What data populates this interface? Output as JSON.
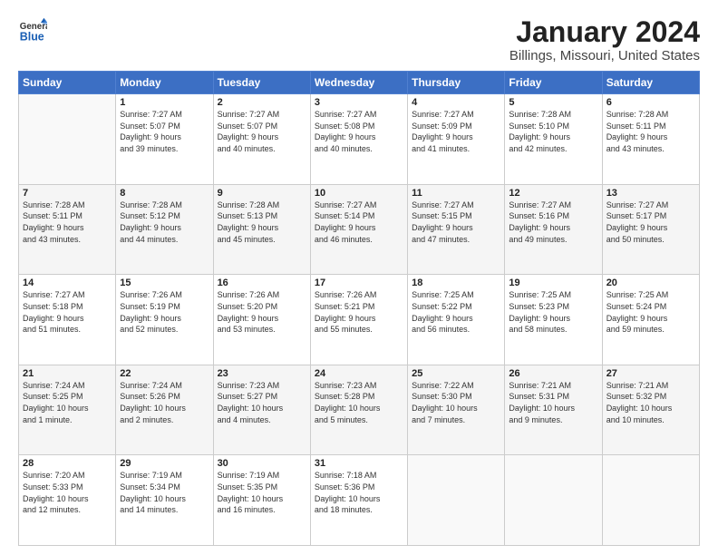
{
  "logo": {
    "general": "General",
    "blue": "Blue"
  },
  "header": {
    "title": "January 2024",
    "subtitle": "Billings, Missouri, United States"
  },
  "weekdays": [
    "Sunday",
    "Monday",
    "Tuesday",
    "Wednesday",
    "Thursday",
    "Friday",
    "Saturday"
  ],
  "weeks": [
    [
      {
        "day": "",
        "info": ""
      },
      {
        "day": "1",
        "info": "Sunrise: 7:27 AM\nSunset: 5:07 PM\nDaylight: 9 hours\nand 39 minutes."
      },
      {
        "day": "2",
        "info": "Sunrise: 7:27 AM\nSunset: 5:07 PM\nDaylight: 9 hours\nand 40 minutes."
      },
      {
        "day": "3",
        "info": "Sunrise: 7:27 AM\nSunset: 5:08 PM\nDaylight: 9 hours\nand 40 minutes."
      },
      {
        "day": "4",
        "info": "Sunrise: 7:27 AM\nSunset: 5:09 PM\nDaylight: 9 hours\nand 41 minutes."
      },
      {
        "day": "5",
        "info": "Sunrise: 7:28 AM\nSunset: 5:10 PM\nDaylight: 9 hours\nand 42 minutes."
      },
      {
        "day": "6",
        "info": "Sunrise: 7:28 AM\nSunset: 5:11 PM\nDaylight: 9 hours\nand 43 minutes."
      }
    ],
    [
      {
        "day": "7",
        "info": "Sunrise: 7:28 AM\nSunset: 5:11 PM\nDaylight: 9 hours\nand 43 minutes."
      },
      {
        "day": "8",
        "info": "Sunrise: 7:28 AM\nSunset: 5:12 PM\nDaylight: 9 hours\nand 44 minutes."
      },
      {
        "day": "9",
        "info": "Sunrise: 7:28 AM\nSunset: 5:13 PM\nDaylight: 9 hours\nand 45 minutes."
      },
      {
        "day": "10",
        "info": "Sunrise: 7:27 AM\nSunset: 5:14 PM\nDaylight: 9 hours\nand 46 minutes."
      },
      {
        "day": "11",
        "info": "Sunrise: 7:27 AM\nSunset: 5:15 PM\nDaylight: 9 hours\nand 47 minutes."
      },
      {
        "day": "12",
        "info": "Sunrise: 7:27 AM\nSunset: 5:16 PM\nDaylight: 9 hours\nand 49 minutes."
      },
      {
        "day": "13",
        "info": "Sunrise: 7:27 AM\nSunset: 5:17 PM\nDaylight: 9 hours\nand 50 minutes."
      }
    ],
    [
      {
        "day": "14",
        "info": "Sunrise: 7:27 AM\nSunset: 5:18 PM\nDaylight: 9 hours\nand 51 minutes."
      },
      {
        "day": "15",
        "info": "Sunrise: 7:26 AM\nSunset: 5:19 PM\nDaylight: 9 hours\nand 52 minutes."
      },
      {
        "day": "16",
        "info": "Sunrise: 7:26 AM\nSunset: 5:20 PM\nDaylight: 9 hours\nand 53 minutes."
      },
      {
        "day": "17",
        "info": "Sunrise: 7:26 AM\nSunset: 5:21 PM\nDaylight: 9 hours\nand 55 minutes."
      },
      {
        "day": "18",
        "info": "Sunrise: 7:25 AM\nSunset: 5:22 PM\nDaylight: 9 hours\nand 56 minutes."
      },
      {
        "day": "19",
        "info": "Sunrise: 7:25 AM\nSunset: 5:23 PM\nDaylight: 9 hours\nand 58 minutes."
      },
      {
        "day": "20",
        "info": "Sunrise: 7:25 AM\nSunset: 5:24 PM\nDaylight: 9 hours\nand 59 minutes."
      }
    ],
    [
      {
        "day": "21",
        "info": "Sunrise: 7:24 AM\nSunset: 5:25 PM\nDaylight: 10 hours\nand 1 minute."
      },
      {
        "day": "22",
        "info": "Sunrise: 7:24 AM\nSunset: 5:26 PM\nDaylight: 10 hours\nand 2 minutes."
      },
      {
        "day": "23",
        "info": "Sunrise: 7:23 AM\nSunset: 5:27 PM\nDaylight: 10 hours\nand 4 minutes."
      },
      {
        "day": "24",
        "info": "Sunrise: 7:23 AM\nSunset: 5:28 PM\nDaylight: 10 hours\nand 5 minutes."
      },
      {
        "day": "25",
        "info": "Sunrise: 7:22 AM\nSunset: 5:30 PM\nDaylight: 10 hours\nand 7 minutes."
      },
      {
        "day": "26",
        "info": "Sunrise: 7:21 AM\nSunset: 5:31 PM\nDaylight: 10 hours\nand 9 minutes."
      },
      {
        "day": "27",
        "info": "Sunrise: 7:21 AM\nSunset: 5:32 PM\nDaylight: 10 hours\nand 10 minutes."
      }
    ],
    [
      {
        "day": "28",
        "info": "Sunrise: 7:20 AM\nSunset: 5:33 PM\nDaylight: 10 hours\nand 12 minutes."
      },
      {
        "day": "29",
        "info": "Sunrise: 7:19 AM\nSunset: 5:34 PM\nDaylight: 10 hours\nand 14 minutes."
      },
      {
        "day": "30",
        "info": "Sunrise: 7:19 AM\nSunset: 5:35 PM\nDaylight: 10 hours\nand 16 minutes."
      },
      {
        "day": "31",
        "info": "Sunrise: 7:18 AM\nSunset: 5:36 PM\nDaylight: 10 hours\nand 18 minutes."
      },
      {
        "day": "",
        "info": ""
      },
      {
        "day": "",
        "info": ""
      },
      {
        "day": "",
        "info": ""
      }
    ]
  ]
}
